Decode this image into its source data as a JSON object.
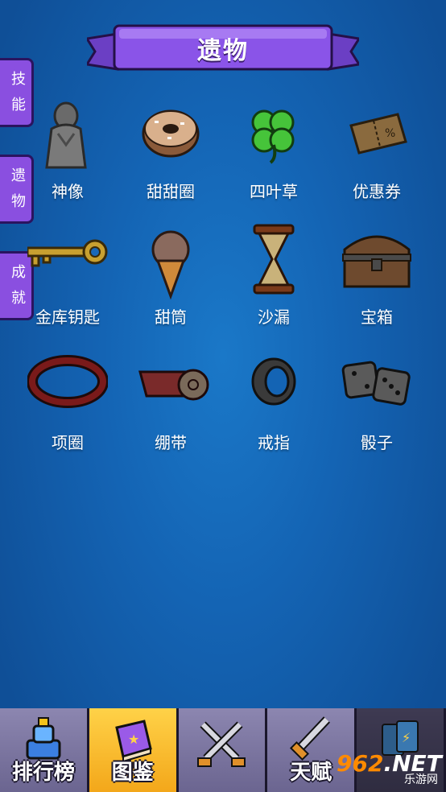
{
  "header": {
    "title": "遗物"
  },
  "side_tabs": [
    {
      "label": "技能"
    },
    {
      "label": "遗物"
    },
    {
      "label": "成就"
    }
  ],
  "items": [
    {
      "name": "神像",
      "icon": "statue-icon"
    },
    {
      "name": "甜甜圈",
      "icon": "donut-icon"
    },
    {
      "name": "四叶草",
      "icon": "clover-icon"
    },
    {
      "name": "优惠券",
      "icon": "coupon-icon"
    },
    {
      "name": "金库钥匙",
      "icon": "key-icon"
    },
    {
      "name": "甜筒",
      "icon": "icecream-icon"
    },
    {
      "name": "沙漏",
      "icon": "hourglass-icon"
    },
    {
      "name": "宝箱",
      "icon": "chest-icon"
    },
    {
      "name": "项圈",
      "icon": "collar-icon"
    },
    {
      "name": "绷带",
      "icon": "bandage-icon"
    },
    {
      "name": "戒指",
      "icon": "ring-icon"
    },
    {
      "name": "骰子",
      "icon": "dice-icon"
    }
  ],
  "bottom_nav": [
    {
      "label": "排行榜",
      "icon": "trophy-icon"
    },
    {
      "label": "图鉴",
      "icon": "book-icon",
      "active": true
    },
    {
      "label": "",
      "icon": "crossed-swords-icon"
    },
    {
      "label": "天赋",
      "icon": "sword-icon"
    },
    {
      "label": "",
      "icon": "cards-icon"
    }
  ],
  "watermark": {
    "number": "962",
    "suffix": ".NET",
    "sub": "乐游网"
  }
}
